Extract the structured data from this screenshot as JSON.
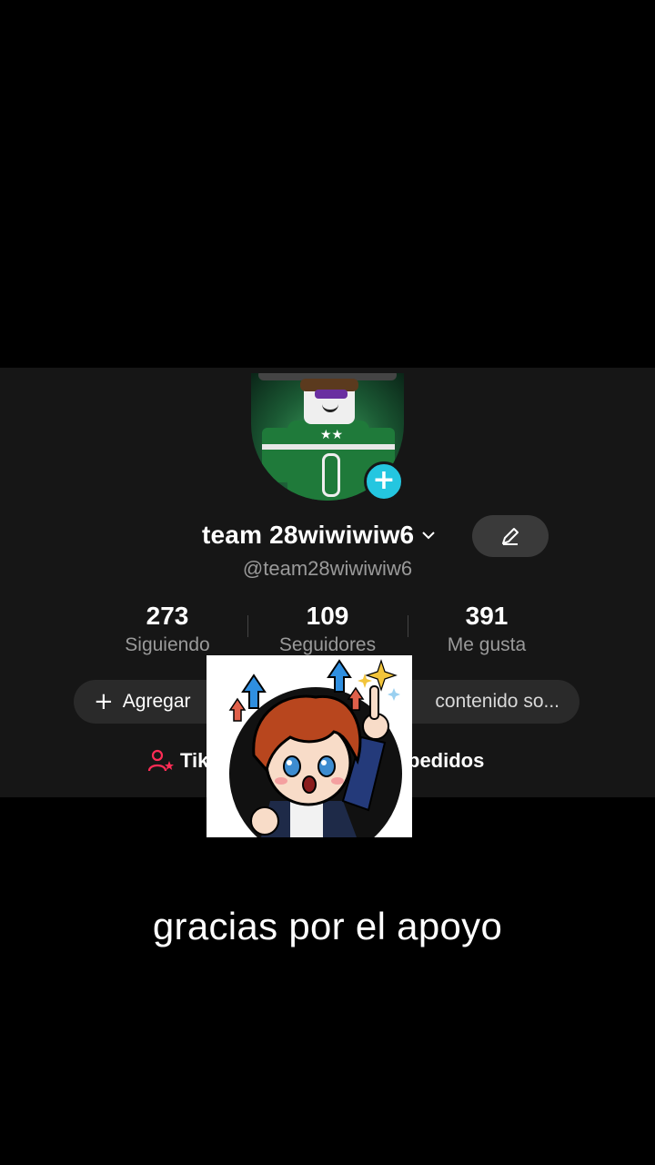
{
  "profile": {
    "display_name": "team 28wiwiwiw6",
    "handle": "@team28wiwiwiw6"
  },
  "stats": [
    {
      "value": "273",
      "label": "Siguiendo"
    },
    {
      "value": "109",
      "label": "Seguidores"
    },
    {
      "value": "391",
      "label": "Me gusta"
    }
  ],
  "actions": {
    "add_label": "Agregar",
    "content_label": "contenido so...",
    "tik_label": "Tik",
    "pedidos_label": "pedidos"
  },
  "caption": "gracias por el apoyo",
  "colors": {
    "accent_badge": "#24c6e0",
    "tiktok_icon": "#fe2c55"
  }
}
